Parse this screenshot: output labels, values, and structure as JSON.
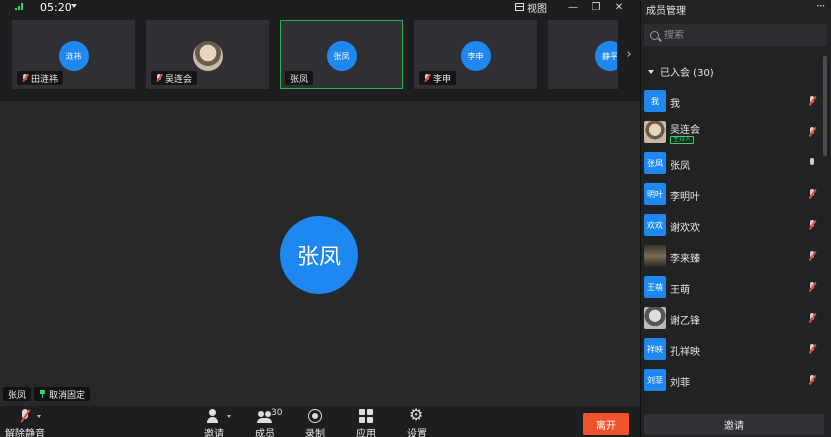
{
  "topbar": {
    "time": "05:20",
    "view_label": "视图"
  },
  "thumbnails": [
    {
      "avatar_text": "涟祎",
      "name": "田涟祎",
      "muted": true,
      "photo": false,
      "active": false
    },
    {
      "avatar_text": "",
      "name": "吴连会",
      "muted": true,
      "photo": true,
      "active": false
    },
    {
      "avatar_text": "张凤",
      "name": "张凤",
      "muted": false,
      "photo": false,
      "active": true
    },
    {
      "avatar_text": "李申",
      "name": "李申",
      "muted": true,
      "photo": false,
      "active": false
    },
    {
      "avatar_text": "静平",
      "name": "",
      "muted": false,
      "photo": false,
      "active": false
    }
  ],
  "stage": {
    "speaker_avatar": "张凤",
    "speaker_tag": "张凤",
    "unpin_label": "取消固定"
  },
  "toolbar": {
    "unmute": "解除静音",
    "invite": "邀请",
    "members": "成员",
    "member_count": "30",
    "record": "录制",
    "apps": "应用",
    "settings": "设置",
    "leave": "离开"
  },
  "panel": {
    "title": "成员管理",
    "more": "···",
    "search_placeholder": "搜索",
    "group_label": "已入会 (30)",
    "invite_label": "邀请",
    "members": [
      {
        "avatar": "我",
        "name": "我",
        "mic": "muted",
        "avatar_style": "blue"
      },
      {
        "avatar": "",
        "name": "吴连会",
        "mic": "muted",
        "avatar_style": "photo1",
        "host": "主持人"
      },
      {
        "avatar": "张凤",
        "name": "张凤",
        "mic": "on",
        "avatar_style": "blue"
      },
      {
        "avatar": "明叶",
        "name": "李明叶",
        "mic": "muted",
        "avatar_style": "blue"
      },
      {
        "avatar": "欢欢",
        "name": "谢欢欢",
        "mic": "muted",
        "avatar_style": "blue"
      },
      {
        "avatar": "",
        "name": "李来臻",
        "mic": "muted",
        "avatar_style": "photo2"
      },
      {
        "avatar": "王萌",
        "name": "王萌",
        "mic": "muted",
        "avatar_style": "blue"
      },
      {
        "avatar": "",
        "name": "谢乙锋",
        "mic": "muted",
        "avatar_style": "photo3"
      },
      {
        "avatar": "祥映",
        "name": "孔祥映",
        "mic": "muted",
        "avatar_style": "blue"
      },
      {
        "avatar": "刘菲",
        "name": "刘菲",
        "mic": "muted",
        "avatar_style": "blue"
      }
    ]
  }
}
